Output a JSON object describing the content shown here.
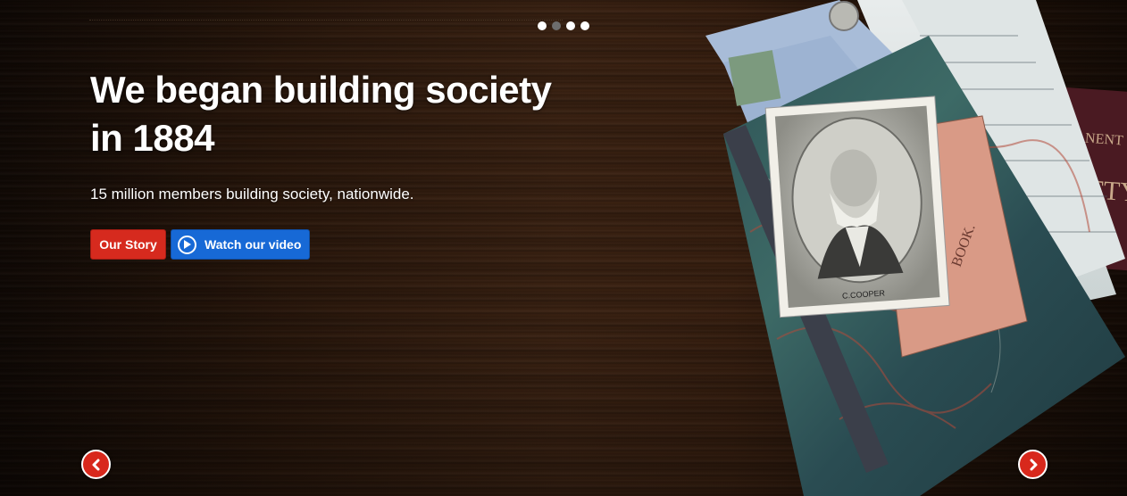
{
  "hero": {
    "headline": "We began building society in 1884",
    "subheadline": "15 million members building society, nationwide.",
    "our_story_label": "Our Story",
    "watch_video_label": "Watch our video"
  },
  "carousel": {
    "slide_count": 4,
    "active_slides": [
      true,
      false,
      true,
      true
    ]
  },
  "artwork": {
    "portrait_caption": "C.COOPER",
    "ledger_text": "BOOK.",
    "spine_text": "NENT",
    "notebook_text": "FTY"
  },
  "colors": {
    "primary_red": "#d62a1e",
    "primary_blue": "#1769d6",
    "background_wood": "#2a170b"
  },
  "icons": {
    "play": "play-circle-icon",
    "prev": "chevron-left-icon",
    "next": "chevron-right-icon"
  }
}
